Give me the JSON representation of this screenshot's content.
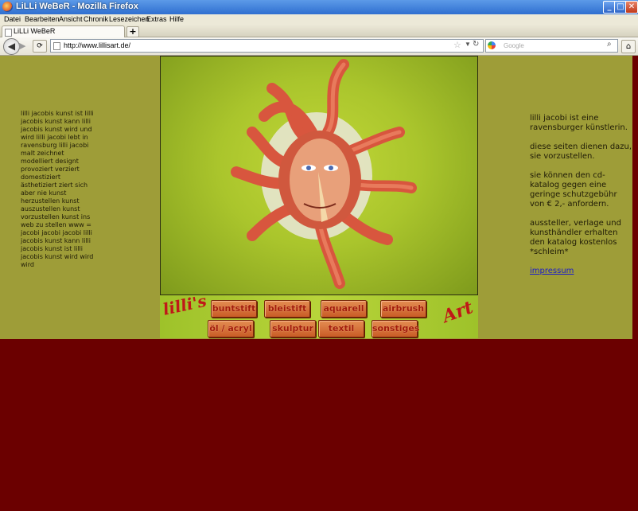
{
  "window": {
    "title": "LiLLi WeBeR - Mozilla Firefox",
    "minimize": "_",
    "maximize": "□",
    "close": "✕"
  },
  "menu": [
    "Datei",
    "Bearbeiten",
    "Ansicht",
    "Chronik",
    "Lesezeichen",
    "Extras",
    "Hilfe"
  ],
  "tabs": [
    {
      "label": "LiLLi WeBeR",
      "icon": "page-icon"
    }
  ],
  "new_tab_label": "+",
  "toolbar": {
    "back_icon": "back-arrow-icon",
    "forward_icon": "forward-arrow-icon",
    "reload_icon": "reload-icon",
    "home_icon": "home-icon"
  },
  "url": {
    "value": "http://www.lillisart.de/"
  },
  "search": {
    "placeholder": "Google",
    "icon": "google-icon"
  },
  "page": {
    "left_text": "lilli jacobis kunst ist lilli jacobis kunst kann lilli jacobis kunst wird und wird lilli jacobi lebt in ravensburg lilli jacobi malt zeichnet modelliert designt provoziert verziert domestiziert ästhetiziert ziert sich aber nie kunst herzustellen kunst auszustellen kunst vorzustellen kunst ins web zu stellen www = jacobi jacobi jacobi lilli jacobis kunst kann lilli jacobis kunst ist lilli jacobis kunst wird wird wird",
    "right_paragraphs": [
      "lilli jacobi ist eine ravensburger künstlerin.",
      "diese seiten dienen dazu, sie vorzustellen.",
      "sie können den cd-katalog gegen eine geringe schutzgebühr von € 2,- anfordern.",
      "aussteller, verlage und kunsthändler erhalten den katalog kostenlos *schleim*"
    ],
    "impressum_link": "impressum",
    "logo_left": "lilli's",
    "logo_right": "Art",
    "nav_row1": [
      "buntstift",
      "bleistift",
      "aquarell",
      "airbrush"
    ],
    "nav_row2": [
      "öl / acryl",
      "skulptur",
      "textil",
      "sonstiges"
    ]
  },
  "colors": {
    "page_olive": "#9e9d38",
    "page_maroon": "#6b0000",
    "artwork_green": "#a6c22a",
    "button_orange": "#d8743a",
    "button_text": "#a31b0a",
    "link_blue": "#1a1acc"
  }
}
